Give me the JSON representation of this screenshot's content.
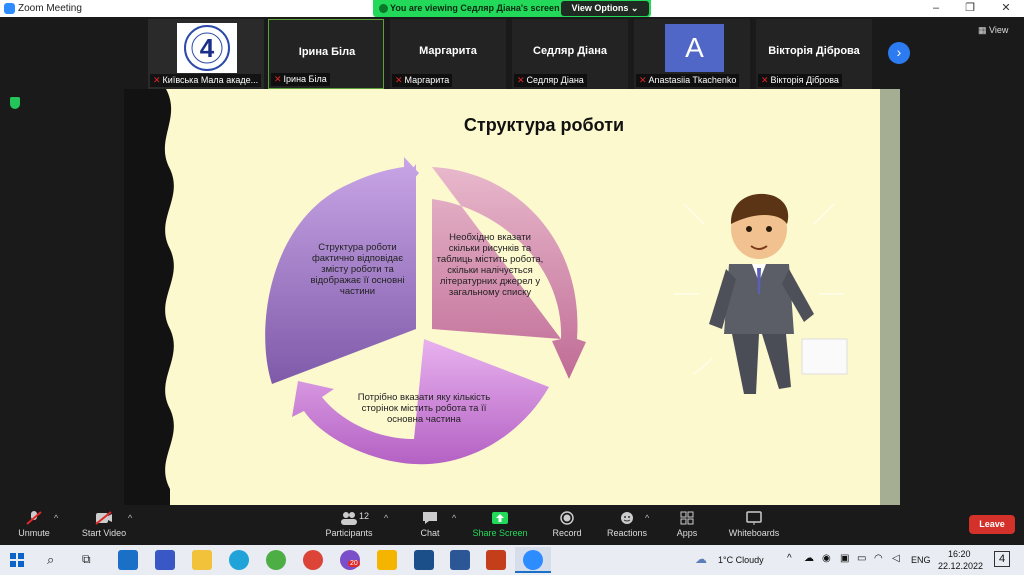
{
  "window": {
    "title": "Zoom Meeting"
  },
  "banner": {
    "message": "You are viewing Седляр Діана's screen",
    "view_options": "View Options"
  },
  "gallery": [
    {
      "display": "logo",
      "label": "Київська Мала акаде..."
    },
    {
      "display": "Ірина Біла",
      "label": "Ірина Біла"
    },
    {
      "display": "Маргарита",
      "label": "Маргарита"
    },
    {
      "display": "Седляр Діана",
      "label": "Седляр Діана"
    },
    {
      "display": "A",
      "label": "Anastasiia Tkachenko"
    },
    {
      "display": "Вікторія Діброва",
      "label": "Вікторія Діброва"
    }
  ],
  "logo_digit": "4",
  "view_label": "View",
  "slide": {
    "title": "Структура роботи",
    "left": "Структура роботи фактично відповідає змісту роботи та відображає її основні частини",
    "right": "Необхідно вказати скільки рисунків та таблиць містить робота, скільки налічується літературних джерел у загальному списку",
    "bottom": "Потрібно вказати яку кількість сторінок містить робота та її основна частина"
  },
  "toolbar": {
    "unmute": "Unmute",
    "start_video": "Start Video",
    "participants": "Participants",
    "participants_count": "12",
    "chat": "Chat",
    "share_screen": "Share Screen",
    "record": "Record",
    "reactions": "Reactions",
    "apps": "Apps",
    "whiteboards": "Whiteboards",
    "leave": "Leave"
  },
  "taskbar": {
    "weather": "1°C  Cloudy",
    "lang": "ENG",
    "time": "16:20",
    "date": "22.12.2022",
    "notifications": "4",
    "viber_badge": "20"
  },
  "colors": {
    "banner": "#23d959",
    "leave": "#d4312b",
    "share": "#23d959",
    "slide_bg": "#fdf9cf",
    "purple": "#9c78c8",
    "pink": "#d88fb0",
    "violet": "#c37bd0"
  }
}
